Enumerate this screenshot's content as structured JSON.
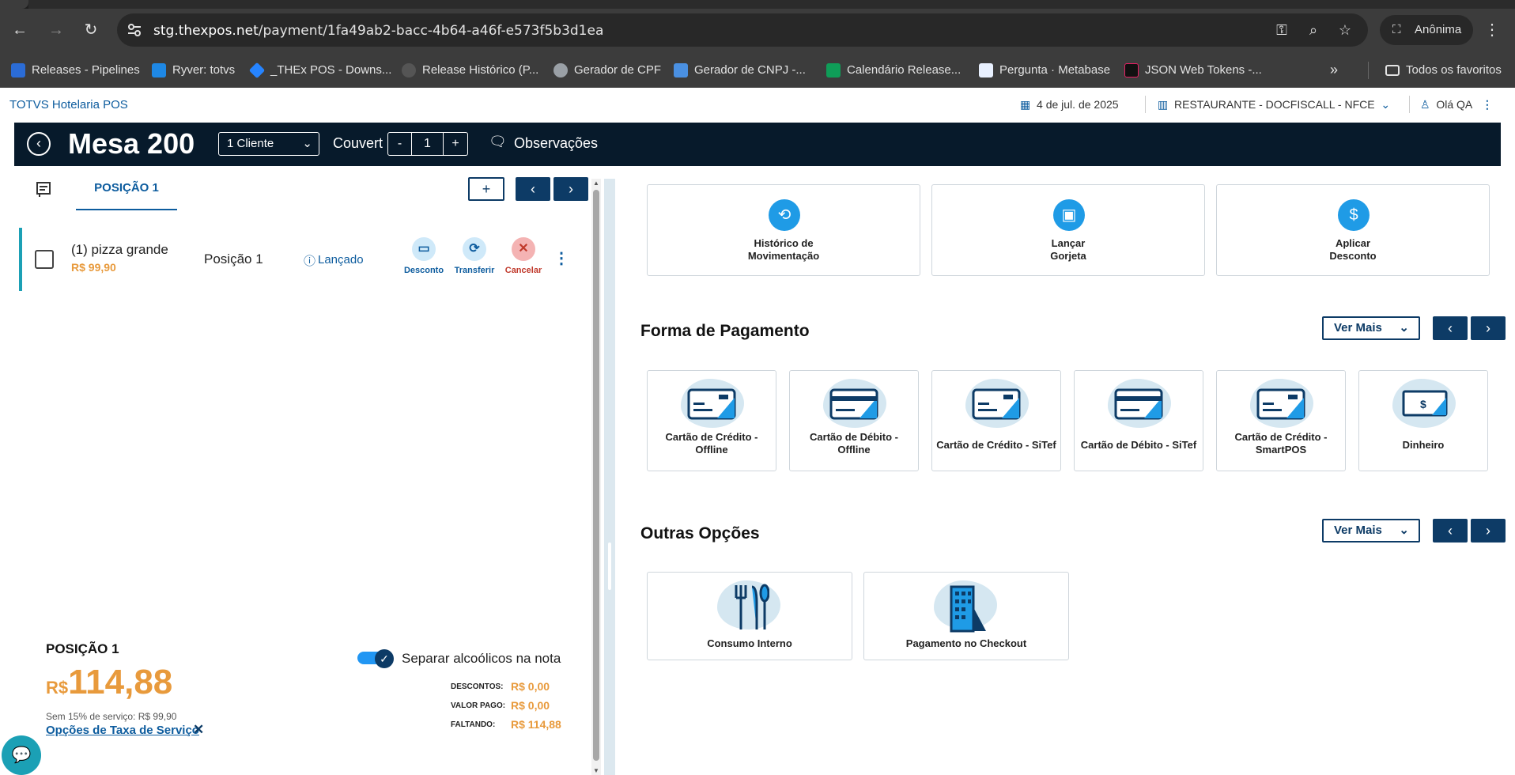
{
  "browser": {
    "url_domain": "stg.thexpos.net",
    "url_path": "/payment/1fa49ab2-bacc-4b64-a46f-e573f5b3d1ea",
    "profile": "Anônima",
    "bookmarks": [
      {
        "label": "Releases - Pipelines",
        "color": "#2b6cd6"
      },
      {
        "label": "Ryver: totvs",
        "color": "#1e88e5"
      },
      {
        "label": "_THEx POS - Downs...",
        "color": "#2684ff"
      },
      {
        "label": "Release Histórico (P...",
        "color": "#555555"
      },
      {
        "label": "Gerador de CPF",
        "color": "#9aa0a6"
      },
      {
        "label": "Gerador de CNPJ -...",
        "color": "#4a90e2"
      },
      {
        "label": "Calendário Release...",
        "color": "#0f9d58"
      },
      {
        "label": "Pergunta · Metabase",
        "color": "#e8f0fe"
      },
      {
        "label": "JSON Web Tokens -...",
        "color": "#111111"
      }
    ],
    "all_bookmarks": "Todos os favoritos"
  },
  "header": {
    "brand": "TOTVS Hotelaria POS",
    "date": "4 de jul. de 2025",
    "store": "RESTAURANTE - DOCFISCALL - NFCE",
    "user": "Olá QA"
  },
  "mesa": {
    "title": "Mesa 200",
    "client_select": "1 Cliente",
    "couvert_label": "Couvert",
    "couvert_minus": "-",
    "couvert_value": "1",
    "couvert_plus": "+",
    "observations": "Observações"
  },
  "left": {
    "tab_position": "POSIÇÃO 1",
    "add_label": "+",
    "prev_label": "‹",
    "next_label": "›",
    "item": {
      "name": "(1)  pizza grande",
      "price": "R$ 99,90",
      "position": "Posição 1",
      "status": "Lançado",
      "actions": {
        "discount": "Desconto",
        "transfer": "Transferir",
        "cancel": "Cancelar"
      }
    },
    "summary": {
      "title": "POSIÇÃO 1",
      "currency": "R$",
      "total": "114,88",
      "service_note": "Sem 15% de serviço: R$ 99,90",
      "service_link": "Opções de Taxa de Serviço",
      "close": "✕",
      "separate_alcohol": "Separar alcoólicos na nota",
      "separate_alcohol_on": true,
      "descontos_label": "DESCONTOS:",
      "descontos_value": "R$ 0,00",
      "valor_pago_label": "VALOR PAGO:",
      "valor_pago_value": "R$ 0,00",
      "faltando_label": "FALTANDO:",
      "faltando_value": "R$ 114,88"
    }
  },
  "quick_actions": [
    {
      "line1": "Histórico de",
      "line2": "Movimentação",
      "icon": "history-icon"
    },
    {
      "line1": "Lançar",
      "line2": "Gorjeta",
      "icon": "wallet-icon"
    },
    {
      "line1": "Aplicar",
      "line2": "Desconto",
      "icon": "dollar-icon"
    }
  ],
  "payment": {
    "title": "Forma de Pagamento",
    "ver_mais": "Ver Mais",
    "methods": [
      {
        "line1": "Cartão de Crédito -",
        "line2": "Offline"
      },
      {
        "line1": "Cartão de Débito -",
        "line2": "Offline"
      },
      {
        "line1": "Cartão de Crédito - SiTef",
        "line2": ""
      },
      {
        "line1": "Cartão de Débito - SiTef",
        "line2": ""
      },
      {
        "line1": "Cartão de Crédito -",
        "line2": "SmartPOS"
      },
      {
        "line1": "Dinheiro",
        "line2": ""
      }
    ]
  },
  "others": {
    "title": "Outras Opções",
    "ver_mais": "Ver Mais",
    "options": [
      {
        "label": "Consumo Interno",
        "icon": "cutlery-icon"
      },
      {
        "label": "Pagamento no Checkout",
        "icon": "building-icon"
      }
    ]
  },
  "colors": {
    "brand_dark": "#071a2b",
    "primary": "#0d3b66",
    "accent_orange": "#e89a3c",
    "icon_blue": "#1f9be6"
  }
}
